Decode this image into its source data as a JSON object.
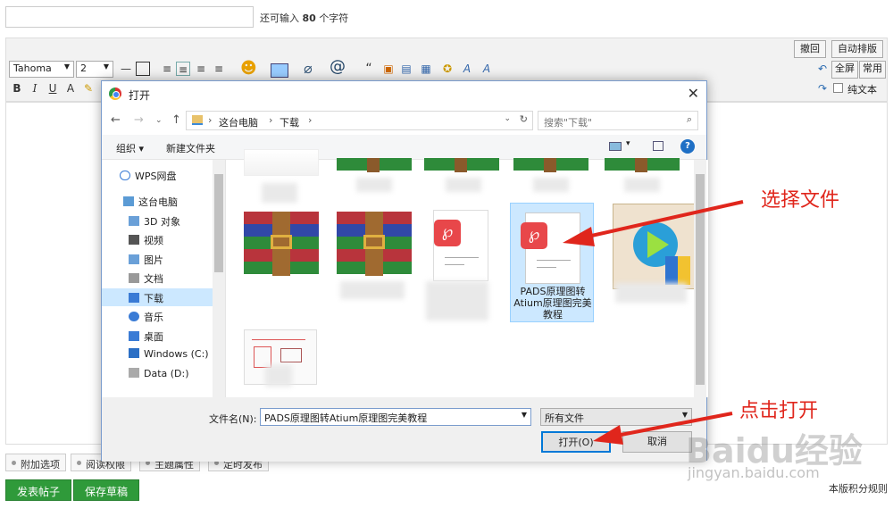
{
  "top": {
    "remain_prefix": "还可输入",
    "remain_count": "80",
    "remain_suffix": "个字符"
  },
  "toolbar": {
    "undo": "撤回",
    "auto_format": "自动排版",
    "font": "Tahoma",
    "size": "2",
    "fullscreen": "全屏",
    "common": "常用",
    "plain_text": "纯文本"
  },
  "bottom_options": [
    "附加选项",
    "阅读权限",
    "主题属性",
    "定时发布"
  ],
  "buttons": {
    "publish": "发表帖子",
    "save_draft": "保存草稿",
    "rules": "本版积分规则"
  },
  "dialog": {
    "title": "打开",
    "path": [
      "这台电脑",
      "下载"
    ],
    "search_placeholder": "搜索\"下载\"",
    "organize": "组织 ▾",
    "new_folder": "新建文件夹",
    "nav": [
      "WPS网盘",
      "这台电脑",
      "3D 对象",
      "视频",
      "图片",
      "文档",
      "下载",
      "音乐",
      "桌面",
      "Windows (C:)",
      "Data (D:)"
    ],
    "selected_file": "PADS原理图转Atium原理图完美教程",
    "filename_label": "文件名(N):",
    "filename_value": "PADS原理图转Atium原理图完美教程",
    "filetype": "所有文件",
    "open": "打开(O)",
    "cancel": "取消"
  },
  "annotations": {
    "select_file": "选择文件",
    "click_open": "点击打开"
  },
  "watermark": {
    "brand": "Baidu经验",
    "url": "jingyan.baidu.com"
  },
  "colors": {
    "accent": "#e0261c",
    "selection": "#cce8ff",
    "green_button": "#2f9a3a"
  }
}
